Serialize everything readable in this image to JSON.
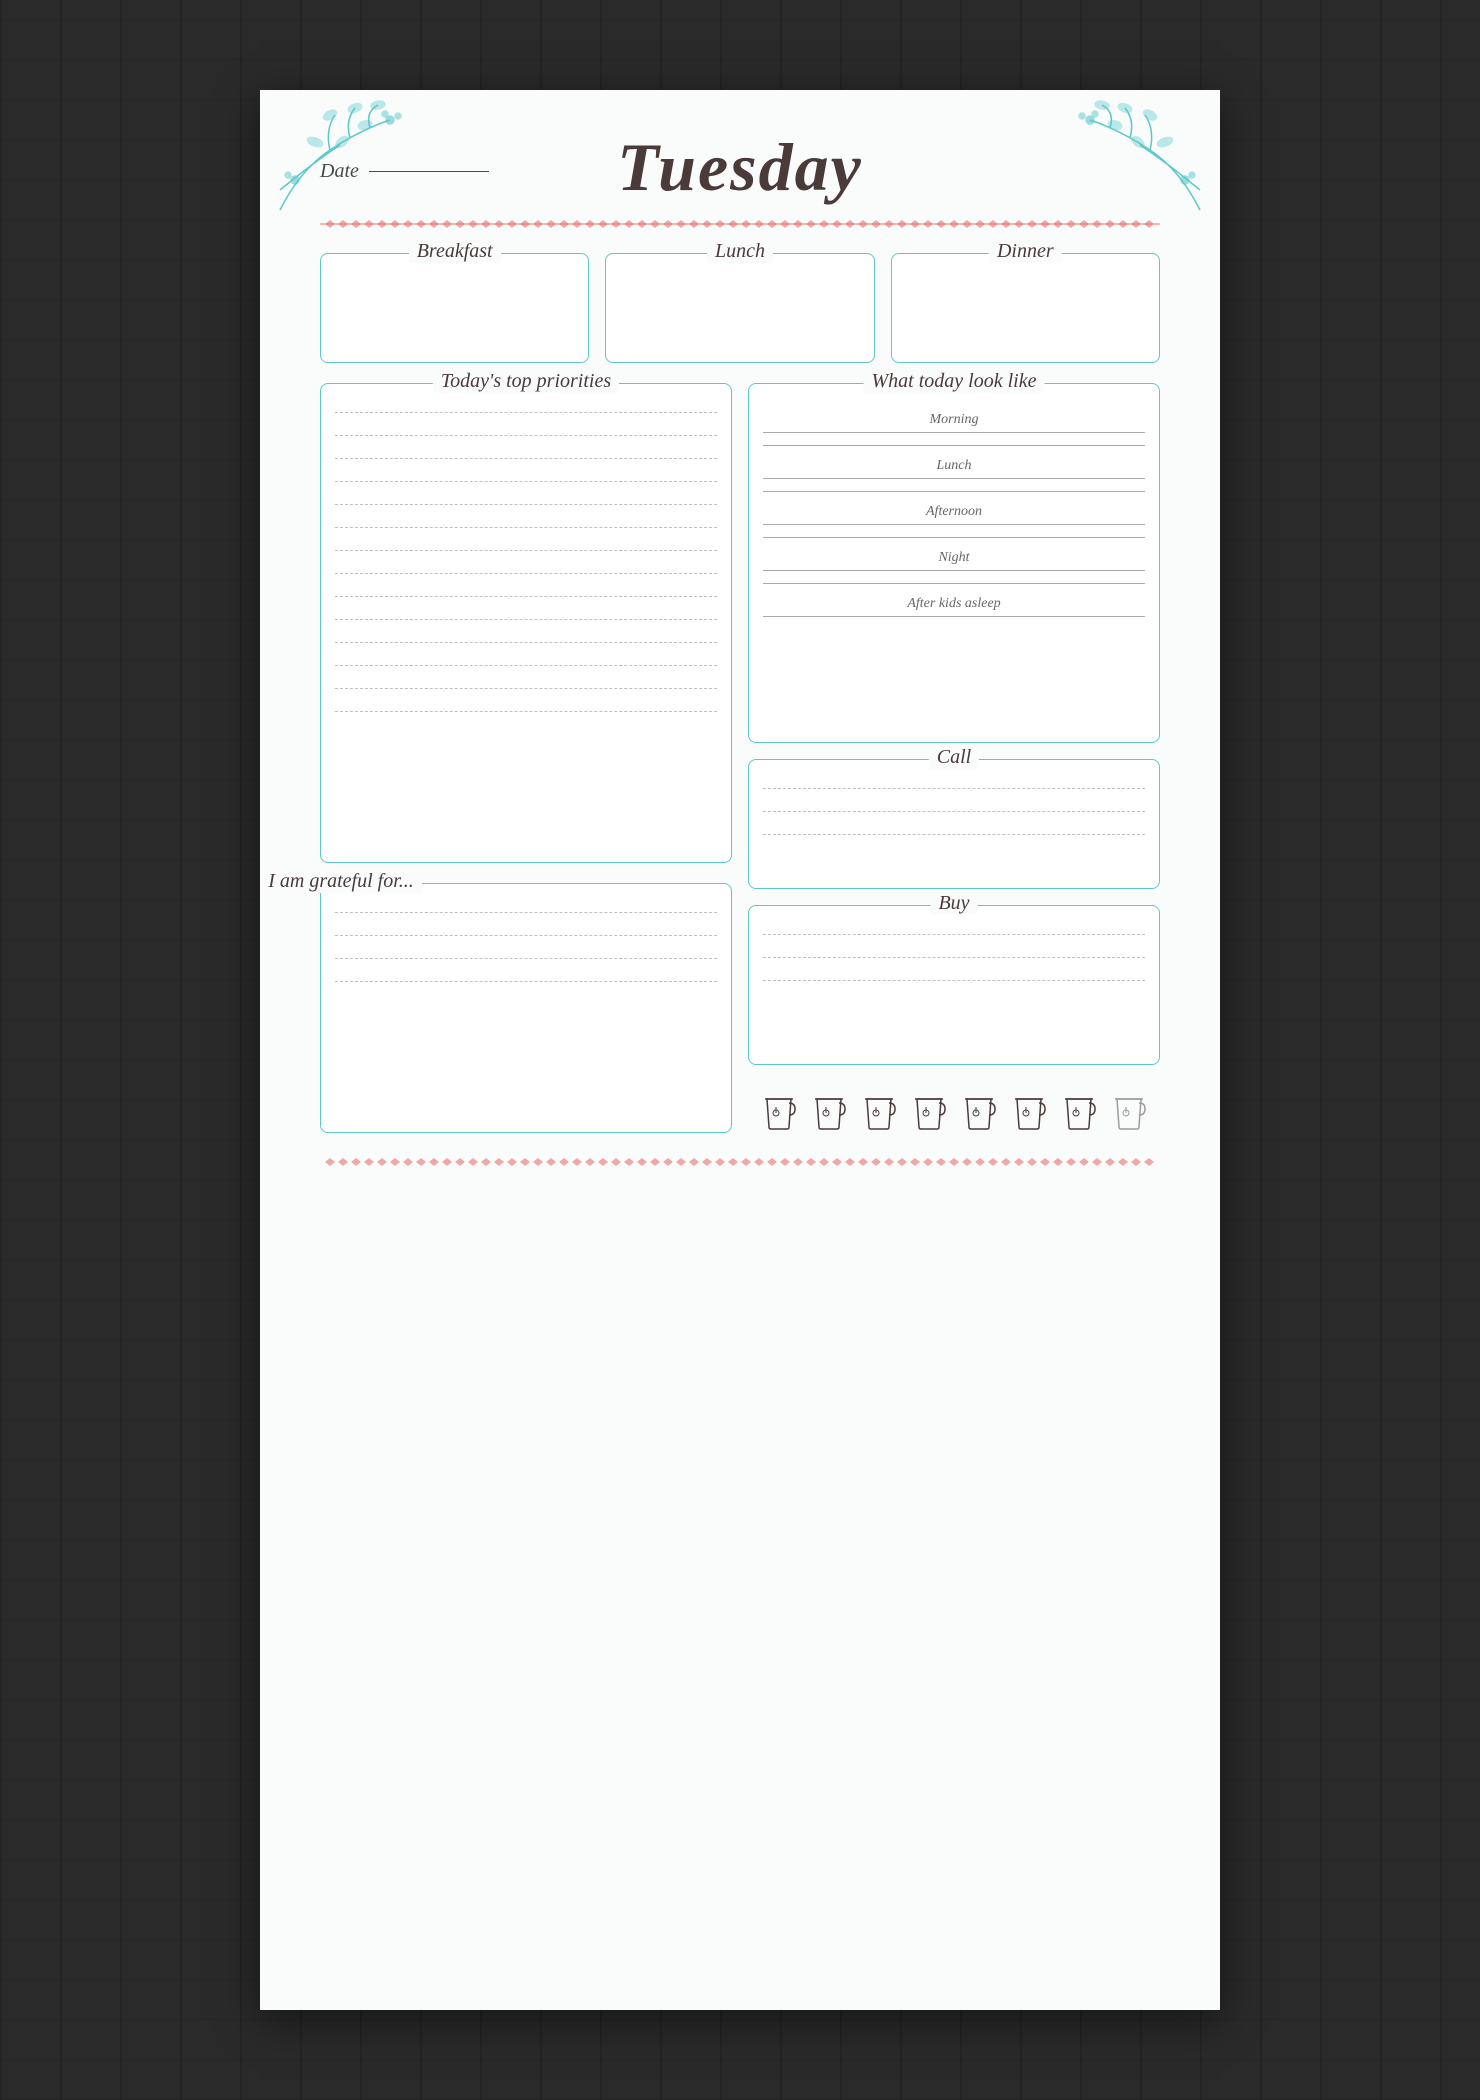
{
  "page": {
    "day": "Tuesday",
    "date_label": "Date",
    "pink_border_color": "#e87070",
    "accent_color": "#5cc8c8"
  },
  "meals": {
    "breakfast_label": "Breakfast",
    "lunch_label": "Lunch",
    "dinner_label": "Dinner"
  },
  "sections": {
    "priorities_label": "Today's top priorities",
    "today_label": "What today look like",
    "call_label": "Call",
    "grateful_label": "I am grateful for...",
    "buy_label": "Buy"
  },
  "today_times": {
    "morning": "Morning",
    "lunch": "Lunch",
    "afternoon": "Afternoon",
    "night": "Night",
    "after_kids": "After kids asleep"
  },
  "water": {
    "cups": [
      1,
      2,
      3,
      4,
      5,
      6,
      7,
      8
    ]
  }
}
